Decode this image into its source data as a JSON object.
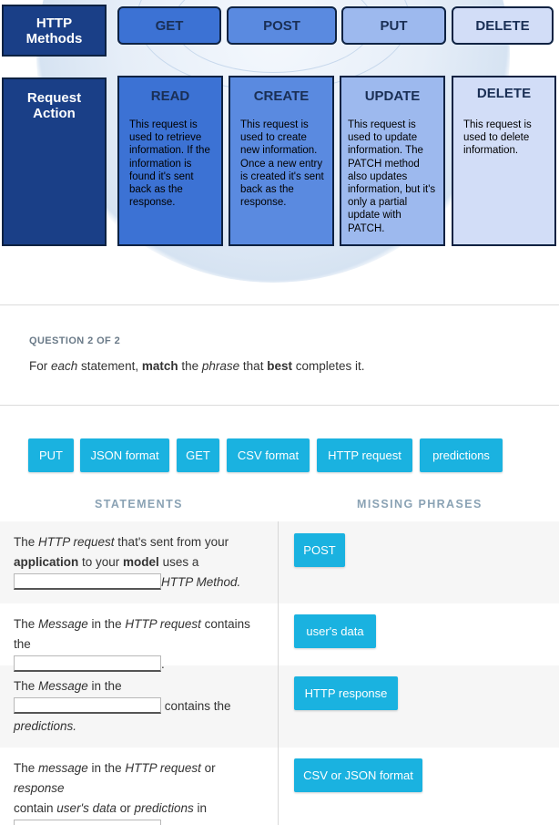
{
  "figure": {
    "row_methods": "HTTP Methods",
    "row_actions": "Request Action",
    "methods": [
      "GET",
      "POST",
      "PUT",
      "DELETE"
    ],
    "actions": [
      {
        "title": "READ",
        "desc": "This request is used to retrieve information. If the information is found it's sent back as the response."
      },
      {
        "title": "CREATE",
        "desc": "This request is used to create new information. Once a new entry is created it's sent back as the response."
      },
      {
        "title": "UPDATE",
        "desc": "This request is used to update information. The PATCH method also updates information, but it's only a partial update with PATCH."
      },
      {
        "title": "DELETE",
        "desc": "This request is used to delete information."
      }
    ],
    "colors": [
      "#3c72d4",
      "#5a8ae0",
      "#9db9ee",
      "#d2ddf7"
    ],
    "label_color": "#1a3f87"
  },
  "question": {
    "number": "QUESTION 2 OF 2",
    "prompt": {
      "p1": "For ",
      "each": "each",
      "p2": " statement, ",
      "match": "match",
      "p3": " the ",
      "phrase": "phrase",
      "p4": " that ",
      "best": "best",
      "p5": " completes it."
    }
  },
  "choices": [
    "PUT",
    "JSON format",
    "GET",
    "CSV format",
    "HTTP request",
    "predictions"
  ],
  "columns": {
    "statements": "STATEMENTS",
    "missing": "MISSING PHRASES"
  },
  "statements": [
    {
      "t1": "The ",
      "i1": "HTTP request",
      "t2": " that's sent from your ",
      "b1": "application",
      "t3": " to your ",
      "b2": "model",
      "t4": " uses a ",
      "i2": "HTTP Method."
    },
    {
      "t1": "The ",
      "i1": "Message",
      "t2": " in the ",
      "i2": "HTTP request",
      "t3": " contains the",
      "t4": "."
    },
    {
      "t1": "The ",
      "i1": "Message",
      "t2": " in the",
      "t3": "contains the",
      "i2": "predictions."
    },
    {
      "t1": "The ",
      "i1": "message",
      "t2": " in the ",
      "i2": "HTTP request",
      "t3": " or ",
      "i3": "response",
      "t4": "contain ",
      "i4": "user's data",
      "t5": " or ",
      "i5": "predictions",
      "t6": " in",
      "t7": "."
    }
  ],
  "missing_phrases": [
    "POST",
    "user's data",
    "HTTP response",
    "CSV or JSON format"
  ],
  "accent_color": "#1ab2e0"
}
